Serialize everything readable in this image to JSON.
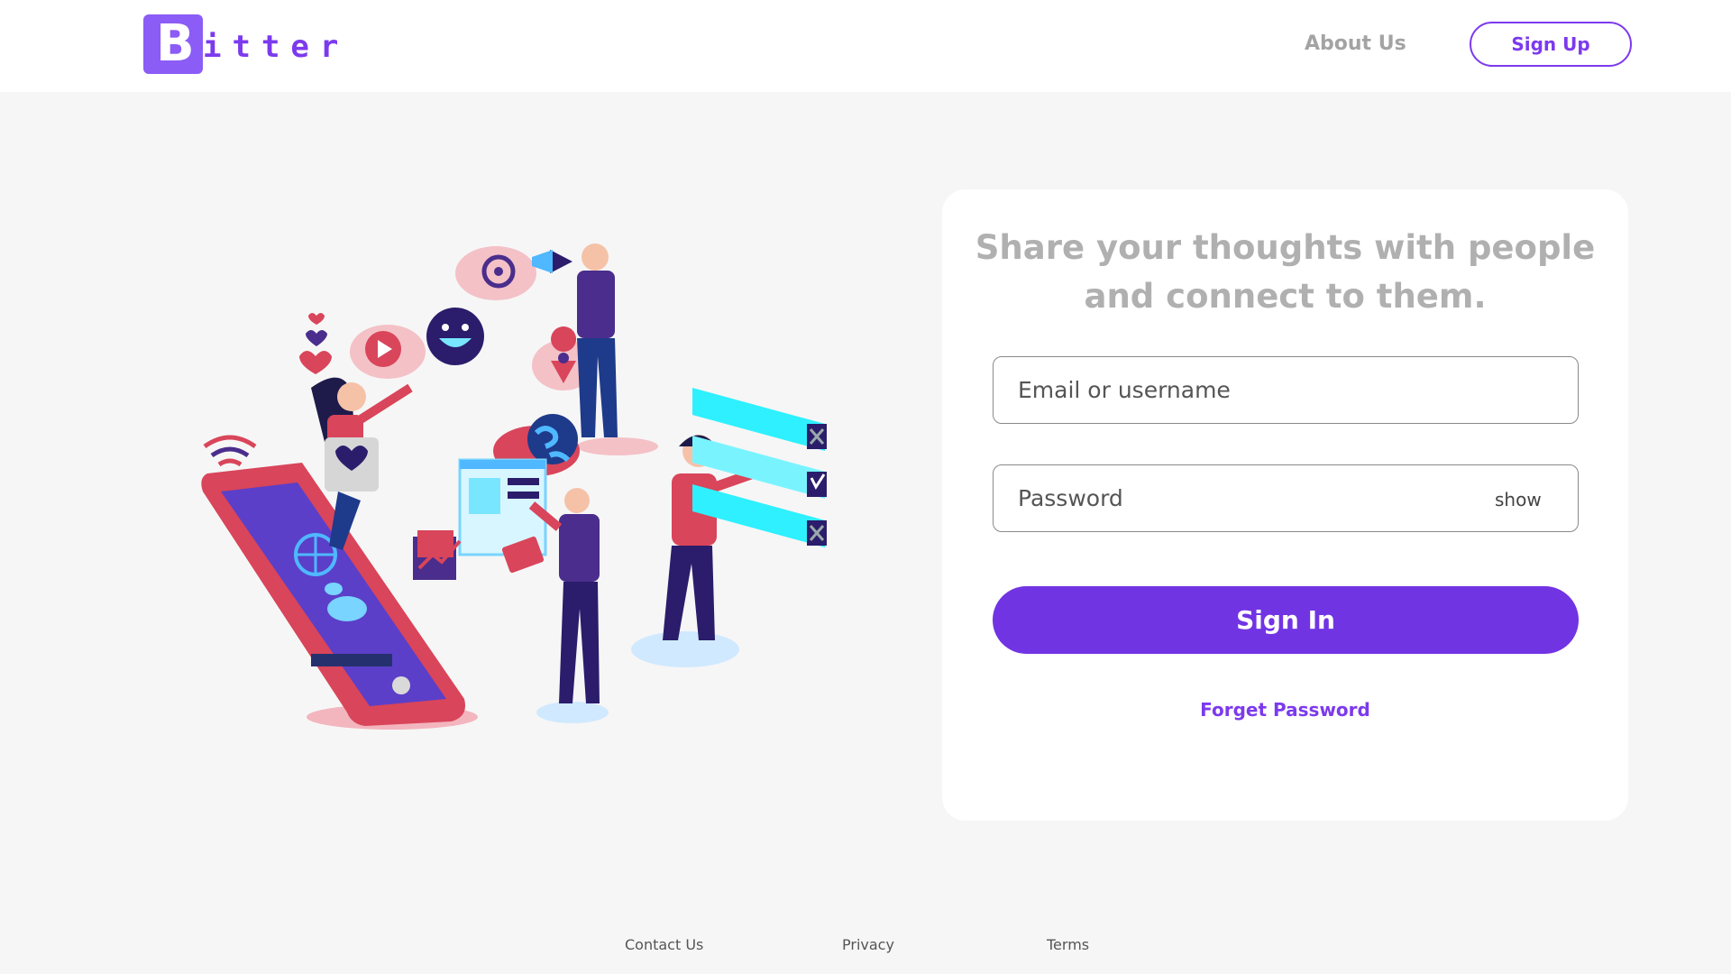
{
  "brand": {
    "logo_letter": "B",
    "logo_rest": "itter",
    "accent": "#7c3aed",
    "logo_bg": "#8b5cf6"
  },
  "nav": {
    "about": "About Us",
    "signup": "Sign Up"
  },
  "card": {
    "tagline_line1": "Share your thoughts with people",
    "tagline_line2": "and connect to them.",
    "email_placeholder": "Email or username",
    "password_placeholder": "Password",
    "show_label": "show",
    "signin_label": "Sign In",
    "signin_color": "#7134e3",
    "forget_label": "Forget Password"
  },
  "footer": {
    "links": [
      "Contact Us",
      "Privacy",
      "Terms"
    ]
  },
  "illustration": {
    "icons": [
      "at-sign-icon",
      "megaphone-icon",
      "smiley-icon",
      "play-icon",
      "location-pin-icon",
      "globe-icon",
      "heart-icon",
      "wifi-icon",
      "checkbox-icon"
    ]
  }
}
